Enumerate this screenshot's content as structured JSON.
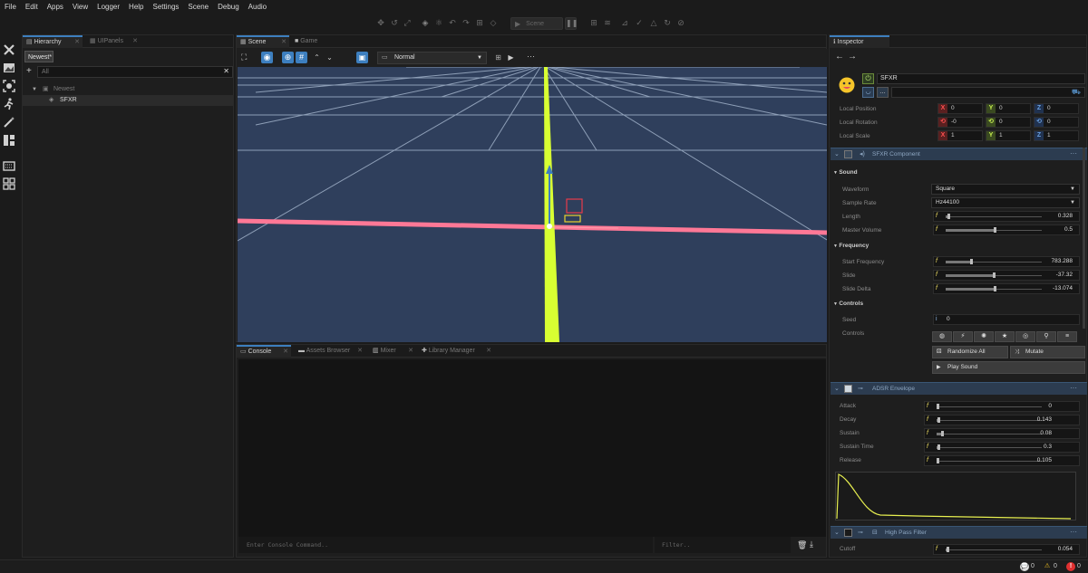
{
  "menu": [
    "File",
    "Edit",
    "Apps",
    "View",
    "Logger",
    "Help",
    "Settings",
    "Scene",
    "Debug",
    "Audio"
  ],
  "toolbar": {
    "play_label": "Scene"
  },
  "hierarchy": {
    "tabs": [
      {
        "label": "Hierarchy"
      },
      {
        "label": "UIPanels"
      }
    ],
    "filter_dropdown": "Newest*",
    "search_placeholder": "All",
    "tree": [
      {
        "label": "Newest"
      },
      {
        "label": "SFXR"
      }
    ]
  },
  "scene": {
    "tabs": [
      {
        "label": "Scene"
      },
      {
        "label": "Game"
      }
    ],
    "render_mode": "Normal"
  },
  "console": {
    "tabs": [
      {
        "label": "Console"
      },
      {
        "label": "Assets Browser"
      },
      {
        "label": "Mixer"
      },
      {
        "label": "Library Manager"
      }
    ],
    "input_placeholder": "Enter Console Command..",
    "filter_placeholder": "Filter.."
  },
  "inspector": {
    "tab": "Inspector",
    "object_name": "SFXR",
    "transform": {
      "position": {
        "label": "Local Position",
        "x": "0",
        "y": "0",
        "z": "0"
      },
      "rotation": {
        "label": "Local Rotation",
        "x": "-0",
        "y": "0",
        "z": "0"
      },
      "scale": {
        "label": "Local Scale",
        "x": "1",
        "y": "1",
        "z": "1"
      }
    },
    "sfxr": {
      "title": "SFXR Component",
      "sound_section": "Sound",
      "waveform_label": "Waveform",
      "waveform": "Square",
      "samplerate_label": "Sample Rate",
      "samplerate": "Hz44100",
      "length_label": "Length",
      "length": "0.328",
      "length_frac": 0.02,
      "mastervol_label": "Master Volume",
      "mastervol": "0.5",
      "mastervol_frac": 0.5,
      "frequency_section": "Frequency",
      "startfreq_label": "Start Frequency",
      "startfreq": "783.288",
      "startfreq_frac": 0.25,
      "slide_label": "Slide",
      "slide": "-37.32",
      "slide_frac": 0.49,
      "slidedelta_label": "Slide Delta",
      "slidedelta": "-13.074",
      "slidedelta_frac": 0.5,
      "controls_section": "Controls",
      "seed_label": "Seed",
      "seed": "0",
      "controls_label": "Controls",
      "randomize_label": "Randomize All",
      "mutate_label": "Mutate",
      "play_label": "Play Sound"
    },
    "adsr": {
      "title": "ADSR Envelope",
      "attack_label": "Attack",
      "attack": "0",
      "attack_frac": 0,
      "decay_label": "Decay",
      "decay": "0.143",
      "decay_frac": 0.01,
      "sustain_label": "Sustain",
      "sustain": "0.08",
      "sustain_frac": 0.04,
      "sustaintime_label": "Sustain Time",
      "sustaintime": "0.3",
      "sustaintime_frac": 0.01,
      "release_label": "Release",
      "release": "0.105",
      "release_frac": 0
    },
    "hpf": {
      "title": "High Pass Filter",
      "cutoff_label": "Cutoff",
      "cutoff": "0.054",
      "cutoff_frac": 0.01
    }
  },
  "status": {
    "messages": "0",
    "warnings": "0",
    "errors": "0"
  },
  "colors": {
    "accent": "#3d7fbf",
    "viewport_bg": "#2f3f5c",
    "y_axis": "#d8ff32",
    "x_axis": "#ff7896"
  }
}
